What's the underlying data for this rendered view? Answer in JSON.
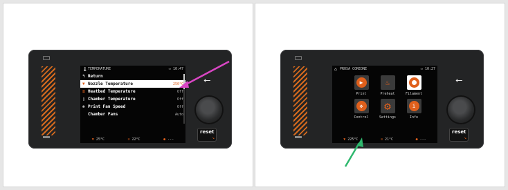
{
  "colors": {
    "accent": "#e0601c",
    "arrow_left": "#d946c4",
    "arrow_right": "#2fb86e"
  },
  "device": {
    "usb_glyph": "⭠",
    "reset_label": "reset",
    "reset_arrow": "↘"
  },
  "left_screen": {
    "status": {
      "title": "TEMPERATURE",
      "time": "10:47"
    },
    "menu": [
      {
        "label": "Return",
        "value": "",
        "icon": "return-icon"
      },
      {
        "label": "Nozzle Temperature",
        "value": "250°C",
        "icon": "nozzle-icon",
        "selected": true
      },
      {
        "label": "Heatbed Temperature",
        "value": "Off",
        "icon": "heatbed-icon"
      },
      {
        "label": "Chamber Temperature",
        "value": "Off",
        "icon": "chamber-icon"
      },
      {
        "label": "Print Fan Speed",
        "value": "Off",
        "icon": "fan-icon"
      },
      {
        "label": "Chamber Fans",
        "value": "Auto",
        "icon": ""
      }
    ],
    "footer": {
      "nozzle": "25°C",
      "bed": "22°C",
      "other": "---"
    }
  },
  "right_screen": {
    "status": {
      "title": "PRUSA COREONE",
      "time": "10:27"
    },
    "tiles": [
      {
        "label": "Print",
        "icon": "play-icon"
      },
      {
        "label": "Preheat",
        "icon": "preheat-icon"
      },
      {
        "label": "Filament",
        "icon": "filament-icon",
        "selected": true
      },
      {
        "label": "Control",
        "icon": "control-icon"
      },
      {
        "label": "Settings",
        "icon": "settings-icon"
      },
      {
        "label": "Info",
        "icon": "info-icon"
      }
    ],
    "footer": {
      "nozzle": "225°C",
      "bed": "21°C",
      "other": "---"
    }
  }
}
